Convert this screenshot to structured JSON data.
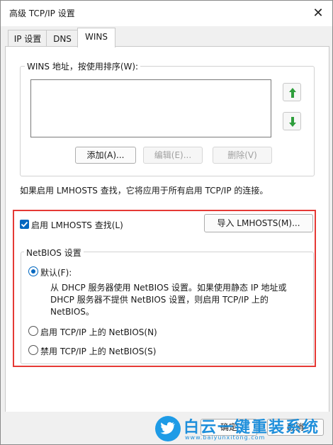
{
  "window": {
    "title": "高级 TCP/IP 设置",
    "close_glyph": "✕"
  },
  "tabs": [
    {
      "label": "IP 设置"
    },
    {
      "label": "DNS"
    },
    {
      "label": "WINS"
    }
  ],
  "wins_group": {
    "label": "WINS 地址，按使用排序(W):",
    "add_button": "添加(A)...",
    "edit_button": "编辑(E)...",
    "delete_button": "删除(V)",
    "up_icon": "arrow-up-icon",
    "down_icon": "arrow-down-icon",
    "accent_color": "#2e9e3c"
  },
  "lmhosts_info": "如果启用 LMHOSTS 查找，它将应用于所有启用 TCP/IP 的连接。",
  "lmhosts": {
    "checkbox_label": "启用 LMHOSTS 查找(L)",
    "checked": true,
    "import_button": "导入 LMHOSTS(M)..."
  },
  "netbios": {
    "group_label": "NetBIOS 设置",
    "option_default": "默认(F):",
    "default_desc": "从 DHCP 服务器使用 NetBIOS 设置。如果使用静态 IP 地址或 DHCP 服务器不提供 NetBIOS 设置，则启用 TCP/IP 上的 NetBIOS。",
    "default_desc_lines": [
      "从 DHCP 服务器使用 NetBIOS 设置。如果使用静态 IP 地址或",
      "DHCP 服务器不提供 NetBIOS 设置，则启用 TCP/IP 上的",
      "NetBIOS。"
    ],
    "option_enable": "启用 TCP/IP 上的 NetBIOS(N)",
    "option_disable": "禁用 TCP/IP 上的 NetBIOS(S)",
    "selected": "default"
  },
  "footer": {
    "ok_button": "确定",
    "cancel_button": "取消"
  },
  "watermark": {
    "main": "白云一键重装系统",
    "sub": "www.baiyunxitong.com"
  },
  "highlight_color": "#e53935",
  "accent_color": "#0067c0"
}
